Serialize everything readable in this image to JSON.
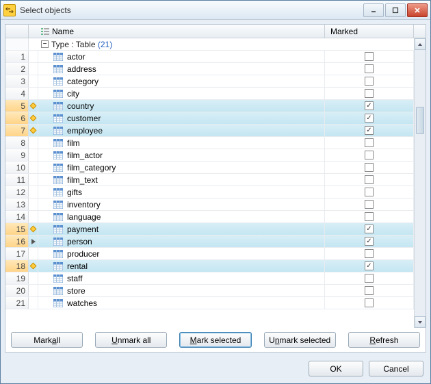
{
  "window": {
    "title": "Select objects"
  },
  "grid": {
    "columns": {
      "name": "Name",
      "marked": "Marked"
    },
    "group_label": "Type : Table",
    "group_count": "(21)",
    "rows": [
      {
        "n": 1,
        "name": "actor",
        "marked": false,
        "selected": false,
        "diamond": false,
        "cursor": false
      },
      {
        "n": 2,
        "name": "address",
        "marked": false,
        "selected": false,
        "diamond": false,
        "cursor": false
      },
      {
        "n": 3,
        "name": "category",
        "marked": false,
        "selected": false,
        "diamond": false,
        "cursor": false
      },
      {
        "n": 4,
        "name": "city",
        "marked": false,
        "selected": false,
        "diamond": false,
        "cursor": false
      },
      {
        "n": 5,
        "name": "country",
        "marked": true,
        "selected": true,
        "diamond": true,
        "cursor": false
      },
      {
        "n": 6,
        "name": "customer",
        "marked": true,
        "selected": true,
        "diamond": true,
        "cursor": false
      },
      {
        "n": 7,
        "name": "employee",
        "marked": true,
        "selected": true,
        "diamond": true,
        "cursor": false
      },
      {
        "n": 8,
        "name": "film",
        "marked": false,
        "selected": false,
        "diamond": false,
        "cursor": false
      },
      {
        "n": 9,
        "name": "film_actor",
        "marked": false,
        "selected": false,
        "diamond": false,
        "cursor": false
      },
      {
        "n": 10,
        "name": "film_category",
        "marked": false,
        "selected": false,
        "diamond": false,
        "cursor": false
      },
      {
        "n": 11,
        "name": "film_text",
        "marked": false,
        "selected": false,
        "diamond": false,
        "cursor": false
      },
      {
        "n": 12,
        "name": "gifts",
        "marked": false,
        "selected": false,
        "diamond": false,
        "cursor": false
      },
      {
        "n": 13,
        "name": "inventory",
        "marked": false,
        "selected": false,
        "diamond": false,
        "cursor": false
      },
      {
        "n": 14,
        "name": "language",
        "marked": false,
        "selected": false,
        "diamond": false,
        "cursor": false
      },
      {
        "n": 15,
        "name": "payment",
        "marked": true,
        "selected": true,
        "diamond": true,
        "cursor": false
      },
      {
        "n": 16,
        "name": "person",
        "marked": true,
        "selected": true,
        "diamond": false,
        "cursor": true
      },
      {
        "n": 17,
        "name": "producer",
        "marked": false,
        "selected": false,
        "diamond": false,
        "cursor": false
      },
      {
        "n": 18,
        "name": "rental",
        "marked": true,
        "selected": true,
        "diamond": true,
        "cursor": false
      },
      {
        "n": 19,
        "name": "staff",
        "marked": false,
        "selected": false,
        "diamond": false,
        "cursor": false
      },
      {
        "n": 20,
        "name": "store",
        "marked": false,
        "selected": false,
        "diamond": false,
        "cursor": false
      },
      {
        "n": 21,
        "name": "watches",
        "marked": false,
        "selected": false,
        "diamond": false,
        "cursor": false
      }
    ]
  },
  "buttons": {
    "mark_all": {
      "pre": "Mark ",
      "u": "a",
      "post": "ll"
    },
    "unmark_all": {
      "pre": "",
      "u": "U",
      "post": "nmark all"
    },
    "mark_selected": {
      "pre": "",
      "u": "M",
      "post": "ark selected"
    },
    "unmark_selected": {
      "pre": "U",
      "u": "n",
      "post": "mark selected"
    },
    "refresh": {
      "pre": "",
      "u": "R",
      "post": "efresh"
    },
    "ok": "OK",
    "cancel": "Cancel"
  }
}
